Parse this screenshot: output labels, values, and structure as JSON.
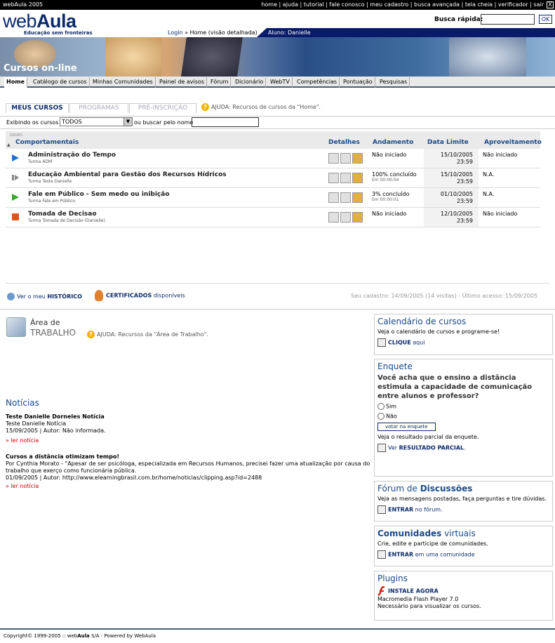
{
  "topbar": {
    "brand": "webAula 2005",
    "links": "home | ajuda | tutorial | fale conosco | meu cadastro | busca avançada | tela cheia | verificador | sair",
    "close": "X"
  },
  "logo": {
    "light": "web",
    "bold": "Aula",
    "slogan": "Educação sem fronteiras"
  },
  "quick": {
    "label": "Busca rápida:",
    "ok": "OK"
  },
  "crumb": {
    "login": "Login",
    "sep": " » ",
    "current": "Home (visão detalhada)"
  },
  "aluno": "Aluno: Danielle",
  "banner": {
    "title": "Cursos on-line"
  },
  "nav": [
    "Home",
    "Catálogo de cursos",
    "Minhas Comunidades",
    "Painel de avisos",
    "Fórum",
    "Dicionário",
    "WebTV",
    "Competências",
    "Pontuação",
    "Pesquisas"
  ],
  "subtabs": [
    "MEUS CURSOS",
    "PROGRAMAS",
    "PRÉ-INSCRIÇÃO"
  ],
  "ajuda1": "AJUDA: Recursos de cursos da \"Home\".",
  "filter": {
    "label": "Exibindo os cursos",
    "value": "TODOS",
    "or": "ou buscar pelo nome"
  },
  "table": {
    "grupo": "GRUPO",
    "group": "Comportamentais",
    "detalhes": "Detalhes",
    "andamento": "Andamento",
    "limite": "Data Limite",
    "aprov": "Aproveitamento",
    "rows": [
      {
        "name": "Administração do Tempo",
        "turma": "Turma ADM",
        "and": "Não iniciado",
        "and2": "",
        "d1": "15/10/2005",
        "d2": "23:59",
        "apr": "Não iniciado",
        "color": "#1f6fd6"
      },
      {
        "name": "Educação Ambiental para Gestão dos Recursos Hídricos",
        "turma": "Turma Teste Danielle",
        "and": "100% concluído",
        "and2": "Em 00:00:04",
        "d1": "15/10/2005",
        "d2": "23:59",
        "apr": "N.A.",
        "color": "#888888"
      },
      {
        "name": "Fale em Público - Sem medo ou inibição",
        "turma": "Turma Fale em Público",
        "and": "3% concluído",
        "and2": "Em 00:00:01",
        "d1": "01/10/2005",
        "d2": "23:59",
        "apr": "N.A.",
        "color": "#3aa62a"
      },
      {
        "name": "Tomada de Decisao",
        "turma": "Turma Tomada de Decisão (Danielle)",
        "and": "Não iniciado",
        "and2": "",
        "d1": "12/10/2005",
        "d2": "23:59",
        "apr": "Não iniciado",
        "color": "#e6501a"
      }
    ]
  },
  "hist": {
    "pre": "Ver o meu ",
    "bold": "HISTÓRICO"
  },
  "cert": {
    "bold": "CERTIFICADOS",
    "post": " disponíveis"
  },
  "seu": "Seu cadastro: 14/09/2005 (14 visitas) - Último acesso: 15/09/2005",
  "wa": {
    "t1": "Área de",
    "t2": "TRABALHO",
    "ajuda": "AJUDA: Recursos da \"Área de Trabalho\"."
  },
  "noticias": {
    "title": "Notícias",
    "items": [
      {
        "title": "Teste Danielle Dorneles Notícia",
        "l1": "Teste Danielle Notícia",
        "l2": "15/09/2005 | Autor: Não informada.",
        "more": "» ler notícia"
      },
      {
        "title": "Cursos a distância otimizam tempo!",
        "l1": "Por Cynthia Morato - \"Apesar de ser psicóloga, especializada em Recursos Humanos, precisei fazer uma atualização por causa do",
        "l1b": "trabalho que exerço como funcionária pública.",
        "l2": "01/09/2005 | Autor: http://www.elearningbrasil.com.br/home/noticias/clipping.asp?id=2488",
        "more": "» ler notícia"
      }
    ]
  },
  "cal": {
    "t1": "Calendário",
    "t2": " de cursos",
    "p": "Veja o calendário de cursos e programe-se!",
    "b": "CLIQUE",
    "a": " aqui"
  },
  "enq": {
    "title": "Enquete",
    "q": "Você acha que o ensino a distância estimula a capacidade de comunicação entre alunos e professor?",
    "o1": "Sim",
    "o2": "Não",
    "votar": "votar na enquete",
    "p": "Veja o resultado parcial da enquete.",
    "a": "Ver ",
    "b": "RESULTADO PARCIAL",
    "dot": "."
  },
  "forum": {
    "t1": "Fórum de ",
    "t2": "Discussões",
    "p": "Veja as mensagens postadas, faça perguntas e tire dúvidas.",
    "b": "ENTRAR",
    "a": " no fórum."
  },
  "com": {
    "t1": "Comunidades",
    "t2": " virtuais",
    "p": "Crie, edite e participe de comunidades.",
    "b": "ENTRAR",
    "a": " em uma comunidade"
  },
  "plug": {
    "title": "Plugins",
    "b": "INSTALE AGORA",
    "l1": "Macromedia Flash Player 7.0",
    "l2": "Necessário para visualizar os cursos."
  },
  "footer": {
    "pre": "Copyright© 1999-2005 :: web",
    "bold": "Aula",
    "post": " S/A - Powered by WebAula"
  }
}
